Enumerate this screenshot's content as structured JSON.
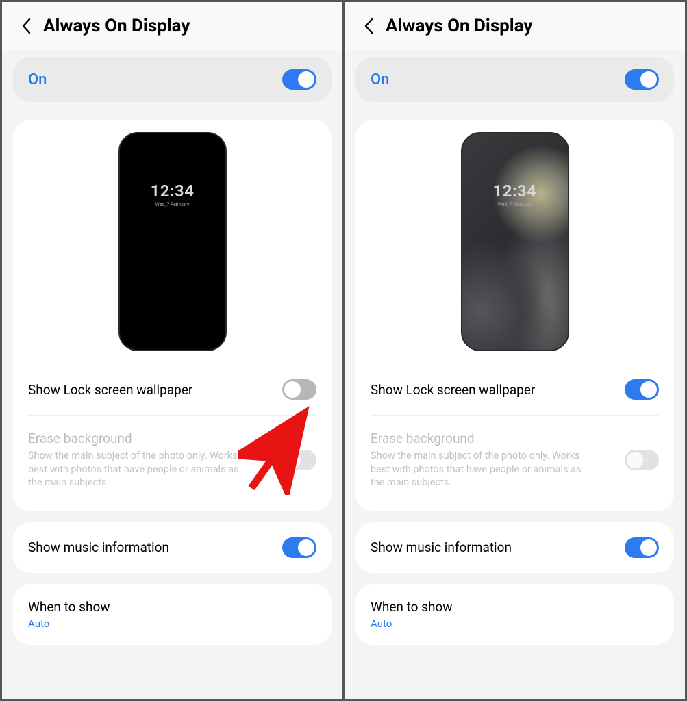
{
  "header": {
    "title": "Always On Display"
  },
  "master": {
    "label": "On"
  },
  "preview": {
    "clock": "12:34",
    "date": "Wed, 7 February"
  },
  "rows": {
    "show_wallpaper": {
      "label": "Show Lock screen wallpaper"
    },
    "erase_bg": {
      "label": "Erase background",
      "desc": "Show the main subject of the photo only. Works best with photos that have people or animals as the main subjects."
    },
    "show_music": {
      "label": "Show music information"
    },
    "when_to_show": {
      "label": "When to show",
      "value": "Auto"
    }
  },
  "panes": {
    "left": {
      "show_wallpaper_on": false,
      "wallpaper_preview": false,
      "has_arrow": true
    },
    "right": {
      "show_wallpaper_on": true,
      "wallpaper_preview": true,
      "has_arrow": false
    }
  }
}
